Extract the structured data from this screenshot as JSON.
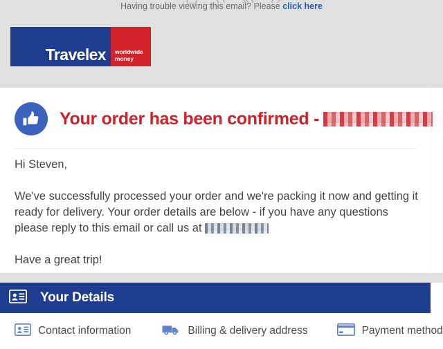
{
  "preheader": {
    "text": "Having trouble viewing this email? Please ",
    "link_label": "click here"
  },
  "mail_toolbar": {
    "icons": [
      "archive-icon",
      "reply-icon",
      "reply-all-icon",
      "forward-icon"
    ]
  },
  "logo": {
    "wordmark": "Travelex",
    "tagline_line1": "worldwide",
    "tagline_line2": "money",
    "blue_hex": "#1e3d8f",
    "red_hex": "#d2232a"
  },
  "message": {
    "badge_icon": "thumbs-up-icon",
    "headline": "Your order has been confirmed -",
    "headline_order_number": "[redacted]",
    "headline_color": "#cc2229",
    "greeting": "Hi Steven,",
    "paragraph_main_before_phone": "We've successfully processed your order and we're packing it now and getting it ready for delivery. Your order details are below - if you have any questions please reply to this email or call us at",
    "phone_number": "[redacted]",
    "closing": "Have a great trip!"
  },
  "section": {
    "icon": "id-card-icon",
    "title": "Your Details",
    "background_hex": "#1e3d8f"
  },
  "detail_links": [
    {
      "icon": "id-card-icon",
      "label": "Contact information"
    },
    {
      "icon": "delivery-truck-icon",
      "label": "Billing & delivery address"
    },
    {
      "icon": "credit-card-icon",
      "label": "Payment method"
    }
  ]
}
